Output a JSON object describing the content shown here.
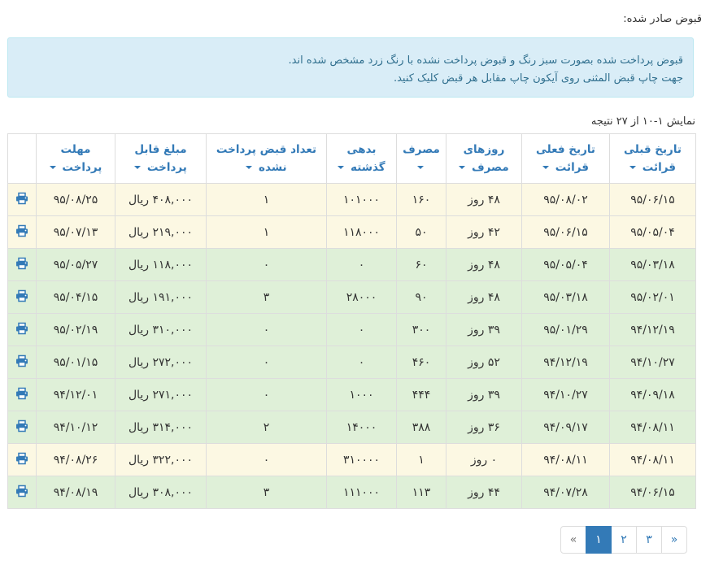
{
  "page": {
    "section_title": "قبوض صادر شده:",
    "alert_line1": "قبوض پرداخت شده بصورت سبز رنگ و قبوض پرداخت نشده با رنگ زرد مشخص شده اند.",
    "alert_line2": "جهت چاپ قبض المثنی روی آیکون چاپ مقابل هر قبض کلیک کنید.",
    "summary": "نمایش ۱-۱۰ از ۲۷ نتیجه"
  },
  "table": {
    "headers": {
      "prev_date": [
        "تاریخ قبلی",
        "قرائت"
      ],
      "curr_date": [
        "تاریخ فعلی",
        "قرائت"
      ],
      "days": [
        "روزهای",
        "مصرف"
      ],
      "usage": [
        "مصرف",
        ""
      ],
      "debt": [
        "بدهی",
        "گذشته"
      ],
      "unpaid_count": [
        "تعداد قبض پرداخت",
        "نشده"
      ],
      "amount": [
        "مبلغ قابل",
        "پرداخت"
      ],
      "deadline": [
        "مهلت",
        "پرداخت"
      ]
    },
    "rows": [
      {
        "status": "unpaid",
        "prev": "۹۵/۰۶/۱۵",
        "curr": "۹۵/۰۸/۰۲",
        "days": "۴۸ روز",
        "usage": "۱۶۰",
        "debt": "۱۰۱۰۰۰",
        "unpaid": "۱",
        "amount": "۴۰۸,۰۰۰ ریال",
        "deadline": "۹۵/۰۸/۲۵"
      },
      {
        "status": "unpaid",
        "prev": "۹۵/۰۵/۰۴",
        "curr": "۹۵/۰۶/۱۵",
        "days": "۴۲ روز",
        "usage": "۵۰",
        "debt": "۱۱۸۰۰۰",
        "unpaid": "۱",
        "amount": "۲۱۹,۰۰۰ ریال",
        "deadline": "۹۵/۰۷/۱۳"
      },
      {
        "status": "paid",
        "prev": "۹۵/۰۳/۱۸",
        "curr": "۹۵/۰۵/۰۴",
        "days": "۴۸ روز",
        "usage": "۶۰",
        "debt": "۰",
        "unpaid": "۰",
        "amount": "۱۱۸,۰۰۰ ریال",
        "deadline": "۹۵/۰۵/۲۷"
      },
      {
        "status": "paid",
        "prev": "۹۵/۰۲/۰۱",
        "curr": "۹۵/۰۳/۱۸",
        "days": "۴۸ روز",
        "usage": "۹۰",
        "debt": "۲۸۰۰۰",
        "unpaid": "۳",
        "amount": "۱۹۱,۰۰۰ ریال",
        "deadline": "۹۵/۰۴/۱۵"
      },
      {
        "status": "paid",
        "prev": "۹۴/۱۲/۱۹",
        "curr": "۹۵/۰۱/۲۹",
        "days": "۳۹ روز",
        "usage": "۳۰۰",
        "debt": "۰",
        "unpaid": "۰",
        "amount": "۳۱۰,۰۰۰ ریال",
        "deadline": "۹۵/۰۲/۱۹"
      },
      {
        "status": "paid",
        "prev": "۹۴/۱۰/۲۷",
        "curr": "۹۴/۱۲/۱۹",
        "days": "۵۲ روز",
        "usage": "۴۶۰",
        "debt": "۰",
        "unpaid": "۰",
        "amount": "۲۷۲,۰۰۰ ریال",
        "deadline": "۹۵/۰۱/۱۵"
      },
      {
        "status": "paid",
        "prev": "۹۴/۰۹/۱۸",
        "curr": "۹۴/۱۰/۲۷",
        "days": "۳۹ روز",
        "usage": "۴۴۴",
        "debt": "۱۰۰۰",
        "unpaid": "۰",
        "amount": "۲۷۱,۰۰۰ ریال",
        "deadline": "۹۴/۱۲/۰۱"
      },
      {
        "status": "paid",
        "prev": "۹۴/۰۸/۱۱",
        "curr": "۹۴/۰۹/۱۷",
        "days": "۳۶ روز",
        "usage": "۳۸۸",
        "debt": "۱۴۰۰۰",
        "unpaid": "۲",
        "amount": "۳۱۴,۰۰۰ ریال",
        "deadline": "۹۴/۱۰/۱۲"
      },
      {
        "status": "unpaid",
        "prev": "۹۴/۰۸/۱۱",
        "curr": "۹۴/۰۸/۱۱",
        "days": "۰ روز",
        "usage": "۱",
        "debt": "۳۱۰۰۰۰",
        "unpaid": "۰",
        "amount": "۳۲۲,۰۰۰ ریال",
        "deadline": "۹۴/۰۸/۲۶"
      },
      {
        "status": "paid",
        "prev": "۹۴/۰۶/۱۵",
        "curr": "۹۴/۰۷/۲۸",
        "days": "۴۴ روز",
        "usage": "۱۱۳",
        "debt": "۱۱۱۰۰۰",
        "unpaid": "۳",
        "amount": "۳۰۸,۰۰۰ ریال",
        "deadline": "۹۴/۰۸/۱۹"
      }
    ]
  },
  "pagination": {
    "prev": "«",
    "pages": [
      "۱",
      "۲",
      "۳"
    ],
    "active": "۱",
    "next": "»"
  },
  "icons": {
    "print": "print-icon",
    "sort": "caret-down-icon"
  },
  "colors": {
    "paid_row": "#dff0d8",
    "unpaid_row": "#fcf8e3",
    "link": "#337ab7",
    "alert_bg": "#d9edf7"
  }
}
